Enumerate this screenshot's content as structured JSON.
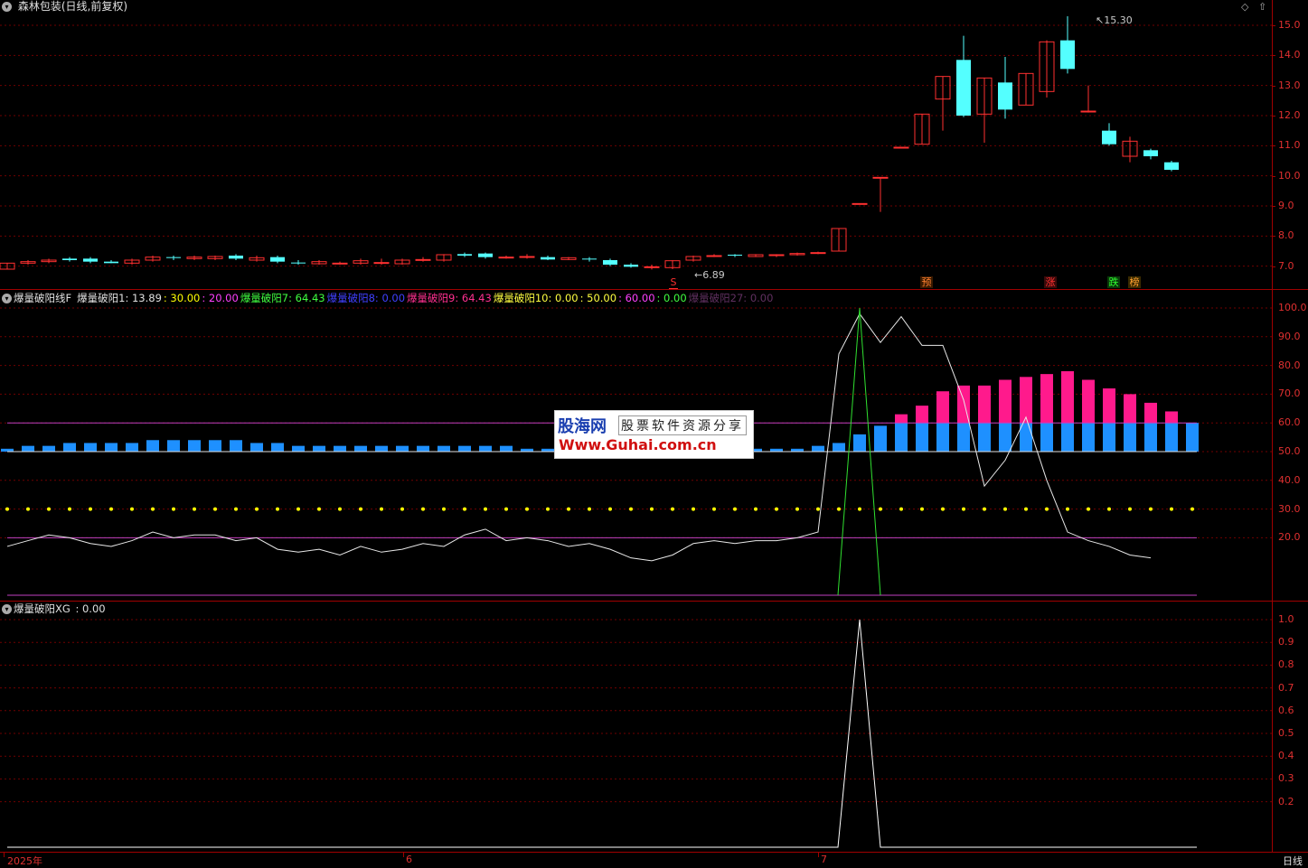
{
  "header": {
    "title": "森林包装(日线,前复权)",
    "price_high_label": "15.30",
    "price_low_label": "6.89"
  },
  "price_axis": [
    "15.0",
    "14.0",
    "13.0",
    "12.0",
    "11.0",
    "10.0",
    "9.0",
    "8.0",
    "7.0"
  ],
  "indicator1": {
    "name": "爆量破阳线F",
    "items": [
      {
        "text": "爆量破阳1: 13.89",
        "color": "#e0e0e0"
      },
      {
        "text": ": 30.00",
        "color": "#ffff00"
      },
      {
        "text": ": 20.00",
        "color": "#ff40ff"
      },
      {
        "text": "爆量破阳7: 64.43",
        "color": "#40ff40"
      },
      {
        "text": "爆量破阳8: 0.00",
        "color": "#4040ff"
      },
      {
        "text": "爆量破阳9: 64.43",
        "color": "#ff3090"
      },
      {
        "text": "爆量破阳10: 0.00",
        "color": "#ffff40"
      },
      {
        "text": ": 50.00",
        "color": "#ffff40"
      },
      {
        "text": ": 60.00",
        "color": "#ff40ff"
      },
      {
        "text": ": 0.00",
        "color": "#40ff40"
      },
      {
        "text": "爆量破阳27: 0.00",
        "color": "#603060"
      }
    ],
    "axis": [
      "100.0",
      "90.0",
      "80.0",
      "70.0",
      "60.0",
      "50.0",
      "40.0",
      "30.0",
      "20.0"
    ]
  },
  "indicator2": {
    "name": "爆量破阳XG",
    "value": ": 0.00",
    "axis": [
      "1.0",
      "0.9",
      "0.8",
      "0.7",
      "0.6",
      "0.5",
      "0.4",
      "0.3",
      "0.2"
    ]
  },
  "badges": [
    {
      "text": "S",
      "color": "#ff3030"
    },
    {
      "text": "预",
      "color": "#ff8030"
    },
    {
      "text": "涨",
      "color": "#ff3030"
    },
    {
      "text": "跌",
      "color": "#30ff30"
    },
    {
      "text": "榜",
      "color": "#ffa030"
    }
  ],
  "date_labels": [
    "2025年",
    "6",
    "7"
  ],
  "period_label": "日线",
  "watermark": {
    "line1": "股海网",
    "line2": "股票软件资源分享",
    "line3": "Www.Guhai.com.cn"
  },
  "colors": {
    "up": "#ff3030",
    "down": "#54ffff",
    "grid": "#800000"
  },
  "chart_data": {
    "type": "candlestick",
    "ylim": [
      6.6,
      15.6
    ],
    "candles": [
      {
        "o": 6.9,
        "c": 7.1,
        "h": 7.1,
        "l": 6.9
      },
      {
        "o": 7.1,
        "c": 7.15,
        "h": 7.2,
        "l": 7.05
      },
      {
        "o": 7.15,
        "c": 7.2,
        "h": 7.25,
        "l": 7.1
      },
      {
        "o": 7.25,
        "c": 7.2,
        "h": 7.3,
        "l": 7.15
      },
      {
        "o": 7.25,
        "c": 7.15,
        "h": 7.3,
        "l": 7.1
      },
      {
        "o": 7.15,
        "c": 7.1,
        "h": 7.2,
        "l": 7.1
      },
      {
        "o": 7.1,
        "c": 7.2,
        "h": 7.25,
        "l": 7.05
      },
      {
        "o": 7.2,
        "c": 7.3,
        "h": 7.35,
        "l": 7.15
      },
      {
        "o": 7.3,
        "c": 7.28,
        "h": 7.35,
        "l": 7.2
      },
      {
        "o": 7.25,
        "c": 7.3,
        "h": 7.35,
        "l": 7.2
      },
      {
        "o": 7.25,
        "c": 7.32,
        "h": 7.35,
        "l": 7.2
      },
      {
        "o": 7.35,
        "c": 7.25,
        "h": 7.4,
        "l": 7.2
      },
      {
        "o": 7.2,
        "c": 7.28,
        "h": 7.35,
        "l": 7.15
      },
      {
        "o": 7.3,
        "c": 7.15,
        "h": 7.35,
        "l": 7.1
      },
      {
        "o": 7.12,
        "c": 7.1,
        "h": 7.2,
        "l": 7.05
      },
      {
        "o": 7.08,
        "c": 7.15,
        "h": 7.2,
        "l": 7.05
      },
      {
        "o": 7.1,
        "c": 7.1,
        "h": 7.15,
        "l": 7.05
      },
      {
        "o": 7.1,
        "c": 7.18,
        "h": 7.25,
        "l": 7.05
      },
      {
        "o": 7.12,
        "c": 7.12,
        "h": 7.25,
        "l": 7.05
      },
      {
        "o": 7.08,
        "c": 7.2,
        "h": 7.25,
        "l": 7.05
      },
      {
        "o": 7.2,
        "c": 7.22,
        "h": 7.3,
        "l": 7.15
      },
      {
        "o": 7.2,
        "c": 7.38,
        "h": 7.4,
        "l": 7.15
      },
      {
        "o": 7.4,
        "c": 7.35,
        "h": 7.45,
        "l": 7.3
      },
      {
        "o": 7.42,
        "c": 7.3,
        "h": 7.45,
        "l": 7.25
      },
      {
        "o": 7.3,
        "c": 7.3,
        "h": 7.35,
        "l": 7.25
      },
      {
        "o": 7.32,
        "c": 7.32,
        "h": 7.4,
        "l": 7.25
      },
      {
        "o": 7.3,
        "c": 7.22,
        "h": 7.35,
        "l": 7.2
      },
      {
        "o": 7.22,
        "c": 7.28,
        "h": 7.3,
        "l": 7.2
      },
      {
        "o": 7.25,
        "c": 7.22,
        "h": 7.3,
        "l": 7.15
      },
      {
        "o": 7.2,
        "c": 7.05,
        "h": 7.25,
        "l": 7.0
      },
      {
        "o": 7.05,
        "c": 6.98,
        "h": 7.1,
        "l": 6.95
      },
      {
        "o": 6.98,
        "c": 6.98,
        "h": 7.05,
        "l": 6.89
      },
      {
        "o": 6.95,
        "c": 7.18,
        "h": 7.2,
        "l": 6.9
      },
      {
        "o": 7.2,
        "c": 7.32,
        "h": 7.35,
        "l": 7.15
      },
      {
        "o": 7.32,
        "c": 7.35,
        "h": 7.4,
        "l": 7.3
      },
      {
        "o": 7.38,
        "c": 7.35,
        "h": 7.4,
        "l": 7.3
      },
      {
        "o": 7.32,
        "c": 7.38,
        "h": 7.4,
        "l": 7.3
      },
      {
        "o": 7.35,
        "c": 7.38,
        "h": 7.4,
        "l": 7.3
      },
      {
        "o": 7.38,
        "c": 7.42,
        "h": 7.45,
        "l": 7.35
      },
      {
        "o": 7.42,
        "c": 7.45,
        "h": 7.48,
        "l": 7.4
      },
      {
        "o": 7.5,
        "c": 8.25,
        "h": 8.25,
        "l": 7.5
      },
      {
        "o": 9.08,
        "c": 9.08,
        "h": 9.08,
        "l": 9.08
      },
      {
        "o": 9.95,
        "c": 9.95,
        "h": 9.95,
        "l": 8.8
      },
      {
        "o": 10.95,
        "c": 10.95,
        "h": 10.95,
        "l": 10.95
      },
      {
        "o": 11.05,
        "c": 12.05,
        "h": 12.05,
        "l": 11.05
      },
      {
        "o": 12.55,
        "c": 13.3,
        "h": 13.3,
        "l": 11.5
      },
      {
        "o": 13.85,
        "c": 12.0,
        "h": 14.65,
        "l": 11.95
      },
      {
        "o": 12.05,
        "c": 13.25,
        "h": 13.25,
        "l": 11.1
      },
      {
        "o": 13.1,
        "c": 12.2,
        "h": 13.95,
        "l": 11.9
      },
      {
        "o": 12.35,
        "c": 13.4,
        "h": 13.4,
        "l": 12.35
      },
      {
        "o": 12.8,
        "c": 14.45,
        "h": 14.5,
        "l": 12.6
      },
      {
        "o": 14.5,
        "c": 13.55,
        "h": 15.3,
        "l": 13.4
      },
      {
        "o": 12.15,
        "c": 12.15,
        "h": 13.0,
        "l": 12.1
      },
      {
        "o": 11.5,
        "c": 11.05,
        "h": 11.75,
        "l": 11.0
      },
      {
        "o": 10.65,
        "c": 11.15,
        "h": 11.3,
        "l": 10.45
      },
      {
        "o": 10.85,
        "c": 10.65,
        "h": 10.9,
        "l": 10.55
      },
      {
        "o": 10.45,
        "c": 10.2,
        "h": 10.5,
        "l": 10.15
      }
    ]
  },
  "indicator_data": {
    "ylim": [
      0,
      102
    ],
    "white_line": [
      17,
      19,
      21,
      20,
      18,
      17,
      19,
      22,
      20,
      21,
      21,
      19,
      20,
      16,
      15,
      16,
      14,
      17,
      15,
      16,
      18,
      17,
      21,
      23,
      19,
      20,
      19,
      17,
      18,
      16,
      13,
      12,
      14,
      18,
      19,
      18,
      19,
      19,
      20,
      22,
      84,
      98,
      88,
      97,
      87,
      87,
      68,
      38,
      47,
      62,
      40,
      22,
      19,
      17,
      14,
      13
    ],
    "green_line": [
      0,
      0,
      0,
      0,
      0,
      0,
      0,
      0,
      0,
      0,
      0,
      0,
      0,
      0,
      0,
      0,
      0,
      0,
      0,
      0,
      0,
      0,
      0,
      0,
      0,
      0,
      0,
      0,
      0,
      0,
      0,
      0,
      0,
      0,
      0,
      0,
      0,
      0,
      0,
      0,
      0,
      100,
      0
    ],
    "blue_bars": [
      51,
      52,
      52,
      53,
      53,
      53,
      53,
      54,
      54,
      54,
      54,
      54,
      53,
      53,
      52,
      52,
      52,
      52,
      52,
      52,
      52,
      52,
      52,
      52,
      52,
      51,
      51,
      51,
      51,
      51,
      51,
      51,
      51,
      51,
      51,
      51,
      51,
      51,
      51,
      52,
      53,
      56,
      59,
      60,
      60,
      60,
      60,
      60,
      60,
      60,
      60,
      60,
      60,
      60,
      60,
      60,
      60,
      60
    ],
    "pink_bars": [
      0,
      0,
      0,
      0,
      0,
      0,
      0,
      0,
      0,
      0,
      0,
      0,
      0,
      0,
      0,
      0,
      0,
      0,
      0,
      0,
      0,
      0,
      0,
      0,
      0,
      0,
      0,
      0,
      0,
      0,
      0,
      0,
      0,
      0,
      0,
      0,
      0,
      0,
      0,
      0,
      0,
      0,
      0,
      63,
      66,
      71,
      73,
      73,
      75,
      76,
      77,
      78,
      75,
      72,
      70,
      67,
      64
    ],
    "dotted_level": 30,
    "hlines": [
      60,
      50,
      20
    ]
  },
  "xg_data": {
    "ylim": [
      0,
      1.05
    ],
    "values_index_peak": 41
  }
}
